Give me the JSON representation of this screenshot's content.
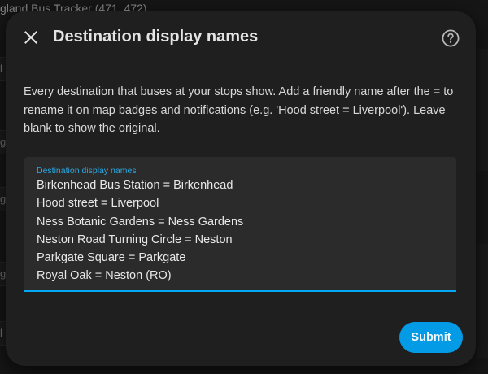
{
  "background": {
    "app_title": "gland Bus Tracker (471, 472)",
    "side_glyphs": [
      "l",
      "gl",
      "gl",
      "gl",
      "l"
    ]
  },
  "dialog": {
    "title": "Destination display names",
    "close_icon": "close-icon",
    "help_icon": "help-circle-icon",
    "description": "Every destination that buses at your stops show. Add a friendly name after the = to rename it on map badges and notifications (e.g. 'Hood street = Liverpool'). Leave blank to show the original.",
    "field": {
      "label": "Destination display names",
      "value": "Birkenhead Bus Station = Birkenhead\nHood street = Liverpool\nNess Botanic Gardens = Ness Gardens\nNeston Road Turning Circle = Neston\nParkgate Square = Parkgate\nRoyal Oak = Neston (RO)"
    },
    "submit_label": "Submit"
  },
  "colors": {
    "accent": "#03a9f4",
    "button": "#039be5",
    "dialog_bg": "#1f1f1f",
    "field_bg": "#2b2b2b"
  }
}
